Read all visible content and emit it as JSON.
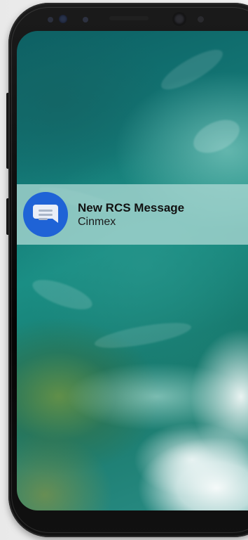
{
  "notification": {
    "app_icon": "messages-icon",
    "title": "New RCS Message",
    "sender": "Cinmex"
  },
  "colors": {
    "icon_background": "#1f63d6",
    "banner_background": "#aad7d2"
  }
}
